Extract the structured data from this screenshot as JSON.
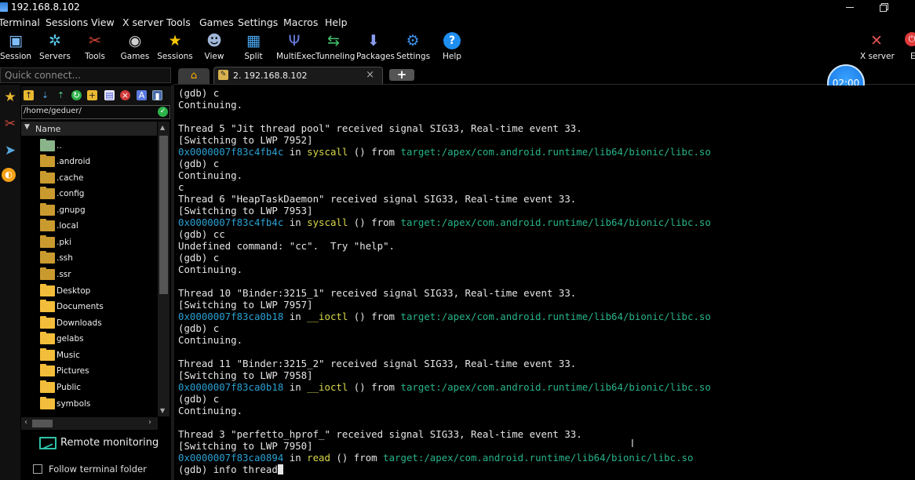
{
  "window": {
    "title": "192.168.8.102"
  },
  "menu": [
    "Terminal",
    "Sessions",
    "View",
    "X server",
    "Tools",
    "Games",
    "Settings",
    "Macros",
    "Help"
  ],
  "toolbar": {
    "buttons": [
      {
        "label": "Session",
        "icon": "session-icon"
      },
      {
        "label": "Servers",
        "icon": "servers-icon"
      },
      {
        "label": "Tools",
        "icon": "tools-icon"
      },
      {
        "label": "Games",
        "icon": "games-icon"
      },
      {
        "label": "Sessions",
        "icon": "star-icon"
      },
      {
        "label": "View",
        "icon": "view-icon"
      },
      {
        "label": "Split",
        "icon": "split-icon"
      },
      {
        "label": "MultiExec",
        "icon": "multiexec-icon"
      },
      {
        "label": "Tunneling",
        "icon": "tunneling-icon"
      },
      {
        "label": "Packages",
        "icon": "packages-icon"
      },
      {
        "label": "Settings",
        "icon": "settings-icon"
      },
      {
        "label": "Help",
        "icon": "help-icon"
      }
    ],
    "xserver": "X server",
    "exit": "E"
  },
  "quick_connect": {
    "placeholder": "Quick connect..."
  },
  "tabs": [
    {
      "label": "2. 192.168.8.102"
    }
  ],
  "timer": "02:00",
  "sftp": {
    "path": "/home/geduer/",
    "column": "Name",
    "items": [
      "..",
      ".android",
      ".cache",
      ".config",
      ".gnupg",
      ".local",
      ".pki",
      ".ssh",
      ".ssr",
      "Desktop",
      "Documents",
      "Downloads",
      "gelabs",
      "Music",
      "Pictures",
      "Public",
      "symbols"
    ],
    "remote_monitoring": "Remote monitoring",
    "follow_folder": "Follow terminal folder"
  },
  "terminal": {
    "lines": [
      [
        [
          "t",
          "(gdb) c"
        ]
      ],
      [
        [
          "t",
          "Continuing."
        ]
      ],
      [
        [
          "t",
          ""
        ]
      ],
      [
        [
          "t",
          "Thread 5 \"Jit thread pool\" received signal SIG33, Real-time event 33."
        ]
      ],
      [
        [
          "t",
          "[Switching to LWP 7952]"
        ]
      ],
      [
        [
          "a",
          "0x0000007f83c4fb4c"
        ],
        [
          "t",
          " in "
        ],
        [
          "f",
          "syscall"
        ],
        [
          "t",
          " () from "
        ],
        [
          "p",
          "target:/apex/com.android.runtime/lib64/bionic/libc.so"
        ]
      ],
      [
        [
          "t",
          "(gdb) c"
        ]
      ],
      [
        [
          "t",
          "Continuing."
        ]
      ],
      [
        [
          "t",
          "c"
        ]
      ],
      [
        [
          "t",
          "Thread 6 \"HeapTaskDaemon\" received signal SIG33, Real-time event 33."
        ]
      ],
      [
        [
          "t",
          "[Switching to LWP 7953]"
        ]
      ],
      [
        [
          "a",
          "0x0000007f83c4fb4c"
        ],
        [
          "t",
          " in "
        ],
        [
          "f",
          "syscall"
        ],
        [
          "t",
          " () from "
        ],
        [
          "p",
          "target:/apex/com.android.runtime/lib64/bionic/libc.so"
        ]
      ],
      [
        [
          "t",
          "(gdb) cc"
        ]
      ],
      [
        [
          "t",
          "Undefined command: \"cc\".  Try \"help\"."
        ]
      ],
      [
        [
          "t",
          "(gdb) c"
        ]
      ],
      [
        [
          "t",
          "Continuing."
        ]
      ],
      [
        [
          "t",
          ""
        ]
      ],
      [
        [
          "t",
          "Thread 10 \"Binder:3215_1\" received signal SIG33, Real-time event 33."
        ]
      ],
      [
        [
          "t",
          "[Switching to LWP 7957]"
        ]
      ],
      [
        [
          "a",
          "0x0000007f83ca0b18"
        ],
        [
          "t",
          " in "
        ],
        [
          "f",
          "__ioctl"
        ],
        [
          "t",
          " () from "
        ],
        [
          "p",
          "target:/apex/com.android.runtime/lib64/bionic/libc.so"
        ]
      ],
      [
        [
          "t",
          "(gdb) c"
        ]
      ],
      [
        [
          "t",
          "Continuing."
        ]
      ],
      [
        [
          "t",
          ""
        ]
      ],
      [
        [
          "t",
          "Thread 11 \"Binder:3215_2\" received signal SIG33, Real-time event 33."
        ]
      ],
      [
        [
          "t",
          "[Switching to LWP 7958]"
        ]
      ],
      [
        [
          "a",
          "0x0000007f83ca0b18"
        ],
        [
          "t",
          " in "
        ],
        [
          "f",
          "__ioctl"
        ],
        [
          "t",
          " () from "
        ],
        [
          "p",
          "target:/apex/com.android.runtime/lib64/bionic/libc.so"
        ]
      ],
      [
        [
          "t",
          "(gdb) c"
        ]
      ],
      [
        [
          "t",
          "Continuing."
        ]
      ],
      [
        [
          "t",
          ""
        ]
      ],
      [
        [
          "t",
          "Thread 3 \"perfetto_hprof_\" received signal SIG33, Real-time event 33."
        ]
      ],
      [
        [
          "t",
          "[Switching to LWP 7950]"
        ]
      ],
      [
        [
          "a",
          "0x0000007f83ca0894"
        ],
        [
          "t",
          " in "
        ],
        [
          "f",
          "read"
        ],
        [
          "t",
          " () from "
        ],
        [
          "p",
          "target:/apex/com.android.runtime/lib64/bionic/libc.so"
        ]
      ],
      [
        [
          "t",
          "(gdb) info thread"
        ]
      ]
    ]
  }
}
